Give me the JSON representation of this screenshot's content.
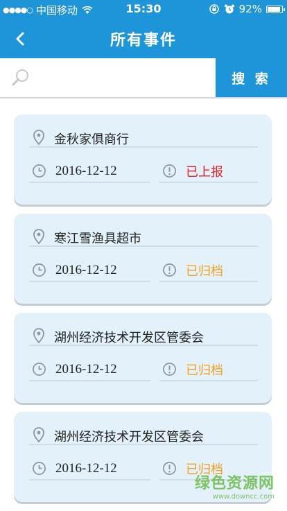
{
  "status_bar": {
    "signal_dots": "●●●●○",
    "carrier": "中国移动",
    "time": "15:30",
    "battery": "92%",
    "battery_level": 0.92
  },
  "header": {
    "title": "所有事件"
  },
  "search": {
    "value": "",
    "placeholder": "",
    "button_label": "搜 索"
  },
  "events": [
    {
      "location": "金秋家俱商行",
      "date": "2016-12-12",
      "status": "已上报",
      "status_color": "#e32020"
    },
    {
      "location": "寒江雪渔具超市",
      "date": "2016-12-12",
      "status": "已归档",
      "status_color": "#f0a020"
    },
    {
      "location": "湖州经济技术开发区管委会",
      "date": "2016-12-12",
      "status": "已归档",
      "status_color": "#f0a020"
    },
    {
      "location": "湖州经济技术开发区管委会",
      "date": "2016-12-12",
      "status": "已归档",
      "status_color": "#f0a020"
    }
  ],
  "watermark": {
    "name": "绿色资源网",
    "url": "www.downcc.com"
  },
  "colors": {
    "primary": "#1e95d9",
    "card_bg": "#e3f1fb"
  }
}
